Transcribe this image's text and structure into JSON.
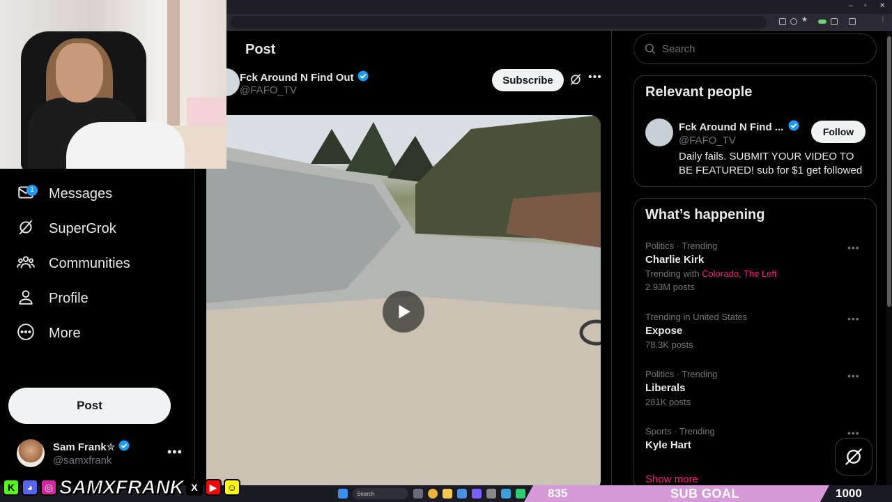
{
  "main": {
    "title": "Post",
    "author": {
      "name": "Fck Around N Find Out",
      "handle": "@FAFO_TV"
    },
    "subscribe_label": "Subscribe"
  },
  "nav": {
    "items": [
      {
        "label": "Messages",
        "icon": "mail-icon",
        "badge": "1"
      },
      {
        "label": "SuperGrok",
        "icon": "grok-icon"
      },
      {
        "label": "Communities",
        "icon": "communities-icon"
      },
      {
        "label": "Profile",
        "icon": "profile-icon"
      },
      {
        "label": "More",
        "icon": "more-circle-icon"
      }
    ],
    "post_label": "Post",
    "account": {
      "name": "Sam Frank✮",
      "handle": "@samxfrank"
    }
  },
  "right": {
    "search_placeholder": "Search",
    "relevant": {
      "title": "Relevant people",
      "name": "Fck Around N Find ...",
      "handle": "@FAFO_TV",
      "bio": "Daily fails. SUBMIT YOUR VIDEO TO BE FEATURED! sub for $1 get followed",
      "follow_label": "Follow"
    },
    "happening": {
      "title": "What’s happening",
      "trends": [
        {
          "meta": "Politics · Trending",
          "topic": "Charlie Kirk",
          "with_prefix": "Trending with ",
          "with_1": "Colorado",
          "with_sep": ", ",
          "with_2": "The Left",
          "count": "2.93M posts"
        },
        {
          "meta": "Trending in United States",
          "topic": "Expose",
          "count": "78.3K posts"
        },
        {
          "meta": "Politics · Trending",
          "topic": "Liberals",
          "count": "281K posts"
        },
        {
          "meta": "Sports · Trending",
          "topic": "Kyle Hart"
        }
      ],
      "show_more": "Show more"
    }
  },
  "overlay": {
    "channel": "SAMXFRANK",
    "goal_current": "835",
    "goal_label": "SUB GOAL",
    "goal_target": "1000"
  },
  "taskbar": {
    "search": "Search"
  },
  "colors": {
    "accent": "#1d9bf0",
    "trend_link": "#f91880",
    "goal_bar": "#d79ad8"
  }
}
